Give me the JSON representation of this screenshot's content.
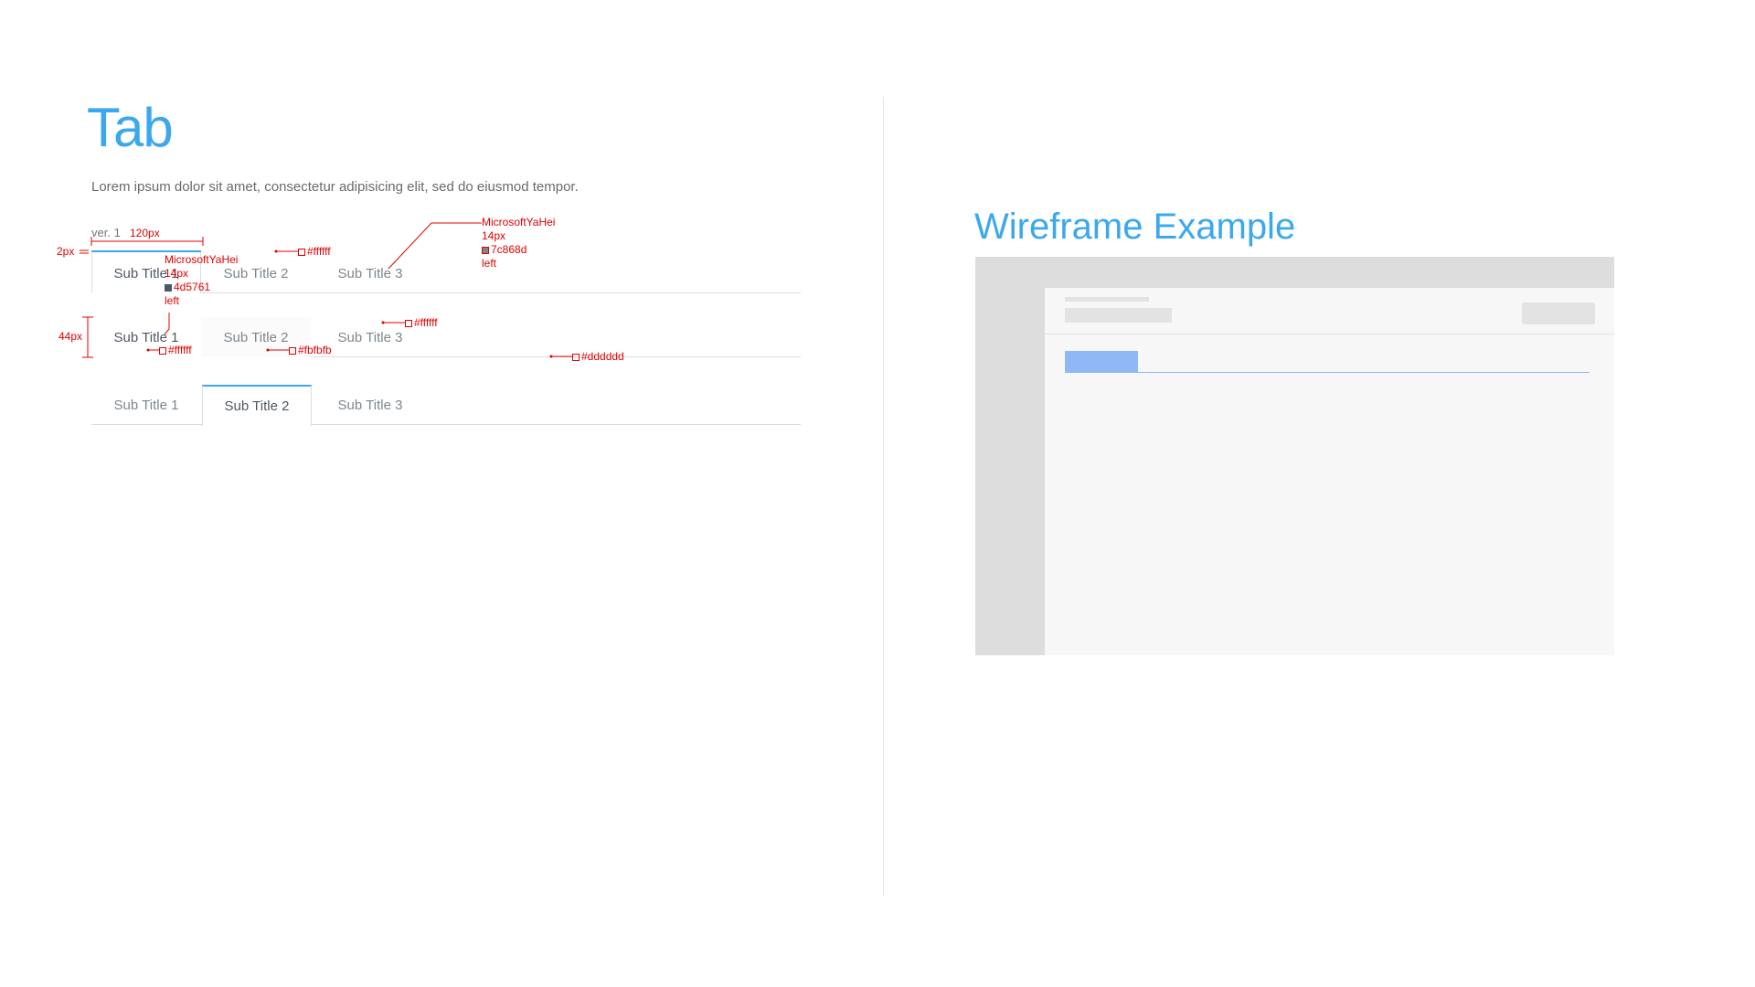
{
  "page": {
    "title": "Tab",
    "description": "Lorem ipsum dolor sit amet, consectetur adipisicing elit, sed do eiusmod tempor.",
    "version_label": "ver. 1"
  },
  "tab_variants": [
    {
      "tabs": [
        "Sub Title 1",
        "Sub Title 2",
        "Sub Title 3"
      ],
      "active_index": 0
    },
    {
      "tabs": [
        "Sub Title 1",
        "Sub Title 2",
        "Sub Title 3"
      ],
      "active_index": 0
    },
    {
      "tabs": [
        "Sub Title 1",
        "Sub Title 2",
        "Sub Title 3"
      ],
      "active_index": 1
    }
  ],
  "annotations": {
    "width_120": "120px",
    "border_2": "2px",
    "height_44": "44px",
    "bg_white_1": "#ffffff",
    "bg_white_2": "#ffffff",
    "bg_white_3": "#ffffff",
    "bg_hover": "#fbfbfb",
    "border_color": "#dddddd",
    "font_inactive": {
      "family": "MicrosoftYaHei",
      "size": "14px",
      "color": "7c868d",
      "align": "left"
    },
    "font_active": {
      "family": "MicrosoftYaHei",
      "size": "14px",
      "color": "4d5761",
      "align": "left"
    }
  },
  "wireframe": {
    "title": "Wireframe Example"
  },
  "colors": {
    "accent": "#3ba8ee",
    "annotation": "#e00000",
    "border": "#dddddd",
    "hover_bg": "#fbfbfb",
    "text_active": "#4d5761",
    "text_inactive": "#7c868d",
    "wireframe_tab": "#8fb9f6"
  }
}
